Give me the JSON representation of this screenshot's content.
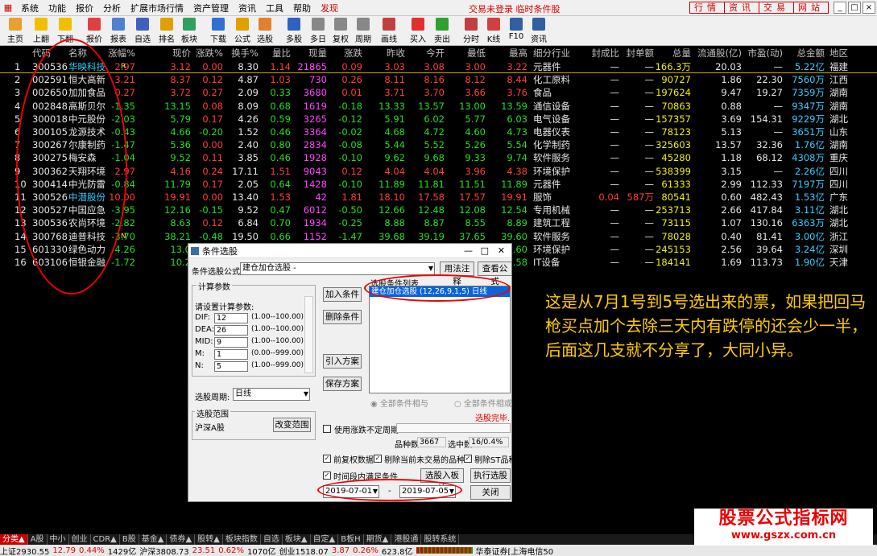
{
  "menu": {
    "items": [
      "系统",
      "功能",
      "报价",
      "分析",
      "扩展市场行情",
      "资产管理",
      "资讯",
      "工具",
      "帮助"
    ],
    "discover": "发现",
    "status": "交易未登录 临时条件股",
    "right_tabs": [
      "行情",
      "资讯",
      "交易",
      "网站"
    ],
    "win_buttons": [
      "_",
      "□",
      "×"
    ]
  },
  "toolbar": [
    "主页",
    "上翻",
    "下翻",
    "报价",
    "报表",
    "自选",
    "排名",
    "板块",
    "下载",
    "公式",
    "选股",
    "多股",
    "多日",
    "复权",
    "周期",
    "画线",
    "买入",
    "卖出",
    "分时",
    "K线",
    "F10",
    "资讯"
  ],
  "columns": [
    "代码",
    "名称",
    "涨幅%",
    "现价",
    "涨跌%",
    "换手%",
    "量比",
    "现量",
    "涨跌",
    "昨收",
    "今开",
    "最低",
    "最高",
    "细分行业",
    "封成比",
    "封单额",
    "总量",
    "流通股(亿)",
    "市盈(动)",
    "总金额",
    "地区"
  ],
  "rows": [
    {
      "n": "1",
      "code": "300536",
      "name": "华映科技",
      "mark": "R",
      "zf": "2.97",
      "xj": "3.12",
      "zd": "0.00",
      "hs": "8.30",
      "lb": "1.14",
      "xl": "21865",
      "zde": "0.09",
      "zs": "3.03",
      "jk": "3.08",
      "zdi": "3.00",
      "zg": "3.22",
      "hy": "元器件",
      "fcb": "—",
      "fde": "—",
      "zl": "166.3万",
      "lt": "20.03",
      "sy": "—",
      "je": "5.22亿",
      "dq": "福建"
    },
    {
      "n": "2",
      "code": "002591",
      "name": "恒大高新",
      "mark": "",
      "zf": "3.21",
      "xj": "8.37",
      "zd": "0.12",
      "hs": "4.87",
      "lb": "1.03",
      "xl": "730",
      "zde": "0.26",
      "zs": "8.11",
      "jk": "8.16",
      "zdi": "8.12",
      "zg": "8.44",
      "hy": "化工原料",
      "fcb": "—",
      "fde": "—",
      "zl": "90727",
      "lt": "1.86",
      "sy": "22.30",
      "je": "7560万",
      "dq": "江西"
    },
    {
      "n": "3",
      "code": "002650",
      "name": "加加食品",
      "mark": "",
      "zf": "0.27",
      "xj": "3.72",
      "zd": "0.27",
      "hs": "2.09",
      "lb": "0.33",
      "xl": "3680",
      "zde": "0.01",
      "zs": "3.71",
      "jk": "3.70",
      "zdi": "3.66",
      "zg": "3.76",
      "hy": "食品",
      "fcb": "—",
      "fde": "—",
      "zl": "197624",
      "lt": "9.47",
      "sy": "19.27",
      "je": "7359万",
      "dq": "湖南"
    },
    {
      "n": "4",
      "code": "002848",
      "name": "高斯贝尔",
      "mark": "",
      "zf": "-1.35",
      "xj": "13.15",
      "zd": "0.08",
      "hs": "8.09",
      "lb": "0.68",
      "xl": "1619",
      "zde": "-0.18",
      "zs": "13.33",
      "jk": "13.57",
      "zdi": "13.00",
      "zg": "13.59",
      "hy": "通信设备",
      "fcb": "—",
      "fde": "—",
      "zl": "70863",
      "lt": "0.88",
      "sy": "—",
      "je": "9347万",
      "dq": "湖南"
    },
    {
      "n": "5",
      "code": "300018",
      "name": "中元股份",
      "mark": "",
      "zf": "-2.03",
      "xj": "5.79",
      "zd": "0.17",
      "hs": "4.26",
      "lb": "0.59",
      "xl": "3265",
      "zde": "-0.12",
      "zs": "5.91",
      "jk": "6.02",
      "zdi": "5.77",
      "zg": "6.03",
      "hy": "电气设备",
      "fcb": "—",
      "fde": "—",
      "zl": "157357",
      "lt": "3.69",
      "sy": "154.31",
      "je": "9229万",
      "dq": "湖北"
    },
    {
      "n": "6",
      "code": "300105",
      "name": "龙源技术",
      "mark": "",
      "zf": "-0.43",
      "xj": "4.66",
      "zd": "-0.20",
      "hs": "1.52",
      "lb": "0.46",
      "xl": "3364",
      "zde": "-0.02",
      "zs": "4.68",
      "jk": "4.72",
      "zdi": "4.60",
      "zg": "4.73",
      "hy": "电器仪表",
      "fcb": "—",
      "fde": "—",
      "zl": "78123",
      "lt": "5.13",
      "sy": "—",
      "je": "3651万",
      "dq": "山东"
    },
    {
      "n": "7",
      "code": "300267",
      "name": "尔康制药",
      "mark": "",
      "zf": "-1.47",
      "xj": "5.36",
      "zd": "0.00",
      "hs": "2.40",
      "lb": "0.80",
      "xl": "2834",
      "zde": "-0.08",
      "zs": "5.44",
      "jk": "5.52",
      "zdi": "5.26",
      "zg": "5.54",
      "hy": "化学制药",
      "fcb": "—",
      "fde": "—",
      "zl": "325603",
      "lt": "13.57",
      "sy": "32.36",
      "je": "1.76亿",
      "dq": "湖南"
    },
    {
      "n": "8",
      "code": "300275",
      "name": "梅安森",
      "mark": "",
      "zf": "-1.04",
      "xj": "9.52",
      "zd": "0.11",
      "hs": "3.85",
      "lb": "0.46",
      "xl": "1928",
      "zde": "-0.10",
      "zs": "9.62",
      "jk": "9.68",
      "zdi": "9.33",
      "zg": "9.74",
      "hy": "软件服务",
      "fcb": "—",
      "fde": "—",
      "zl": "45280",
      "lt": "1.18",
      "sy": "68.12",
      "je": "4308万",
      "dq": "重庆"
    },
    {
      "n": "9",
      "code": "300362",
      "name": "天翔环境",
      "mark": "",
      "zf": "2.97",
      "xj": "4.16",
      "zd": "0.24",
      "hs": "17.11",
      "lb": "1.51",
      "xl": "9043",
      "zde": "0.12",
      "zs": "4.04",
      "jk": "4.04",
      "zdi": "3.96",
      "zg": "4.38",
      "hy": "环境保护",
      "fcb": "—",
      "fde": "—",
      "zl": "538399",
      "lt": "3.15",
      "sy": "—",
      "je": "2.26亿",
      "dq": "四川"
    },
    {
      "n": "10",
      "code": "300414",
      "name": "中光防雷",
      "mark": "",
      "zf": "-0.84",
      "xj": "11.79",
      "zd": "0.17",
      "hs": "2.05",
      "lb": "0.64",
      "xl": "1428",
      "zde": "-0.10",
      "zs": "11.89",
      "jk": "11.81",
      "zdi": "11.51",
      "zg": "11.89",
      "hy": "元器件",
      "fcb": "—",
      "fde": "—",
      "zl": "61333",
      "lt": "2.99",
      "sy": "112.33",
      "je": "7197万",
      "dq": "四川"
    },
    {
      "n": "11",
      "code": "300526",
      "name": "中潜股份",
      "mark": "",
      "zf": "10.00",
      "xj": "19.91",
      "zd": "0.00",
      "hs": "13.40",
      "lb": "1.53",
      "xl": "42",
      "zde": "1.81",
      "zs": "18.10",
      "jk": "17.58",
      "zdi": "17.57",
      "zg": "19.91",
      "hy": "服饰",
      "fcb": "0.04",
      "fde": "587万",
      "zl": "80541",
      "lt": "0.60",
      "sy": "482.43",
      "je": "1.53亿",
      "dq": "广东"
    },
    {
      "n": "12",
      "code": "300527",
      "name": "中国应急",
      "mark": "",
      "zf": "-3.95",
      "xj": "12.16",
      "zd": "-0.15",
      "hs": "9.52",
      "lb": "0.47",
      "xl": "6012",
      "zde": "-0.50",
      "zs": "12.66",
      "jk": "12.48",
      "zdi": "12.08",
      "zg": "12.54",
      "hy": "专用机械",
      "fcb": "—",
      "fde": "—",
      "zl": "253713",
      "lt": "2.66",
      "sy": "417.84",
      "je": "3.11亿",
      "dq": "湖北"
    },
    {
      "n": "13",
      "code": "300536",
      "name": "农尚环境",
      "mark": "",
      "zf": "-2.82",
      "xj": "8.63",
      "zd": "0.12",
      "hs": "6.84",
      "lb": "0.70",
      "xl": "1934",
      "zde": "-0.25",
      "zs": "8.88",
      "jk": "8.87",
      "zdi": "8.55",
      "zg": "8.89",
      "hy": "建筑工程",
      "fcb": "—",
      "fde": "—",
      "zl": "73115",
      "lt": "1.07",
      "sy": "130.16",
      "je": "6363万",
      "dq": "湖北"
    },
    {
      "n": "14",
      "code": "300768",
      "name": "迪普科技",
      "mark": "N",
      "zf": "-3.70",
      "xj": "38.21",
      "zd": "-0.48",
      "hs": "19.50",
      "lb": "0.66",
      "xl": "1152",
      "zde": "-1.47",
      "zs": "39.68",
      "jk": "39.19",
      "zdi": "37.65",
      "zg": "39.60",
      "hy": "软件服务",
      "fcb": "—",
      "fde": "—",
      "zl": "78028",
      "lt": "0.40",
      "sy": "81.41",
      "je": "3.00亿",
      "dq": "浙江"
    },
    {
      "n": "15",
      "code": "601330",
      "name": "绿色动力",
      "mark": "",
      "zf": "-4.26",
      "xj": "13.0",
      "zd": "",
      "hs": "",
      "lb": "",
      "xl": "",
      "zde": "",
      "zs": "",
      "jk": "",
      "zdi": "",
      "zg": ".60",
      "hy": "环境保护",
      "fcb": "—",
      "fde": "—",
      "zl": "245153",
      "lt": "2.56",
      "sy": "39.64",
      "je": "3.24亿",
      "dq": "深圳"
    },
    {
      "n": "16",
      "code": "603106",
      "name": "恒银金融",
      "mark": "",
      "zf": "-1.72",
      "xj": "10.2",
      "zd": "",
      "hs": "",
      "lb": "",
      "xl": "",
      "zde": "",
      "zs": "",
      "jk": "",
      "zdi": "",
      "zg": ".58",
      "hy": "IT设备",
      "fcb": "—",
      "fde": "—",
      "zl": "184141",
      "lt": "1.69",
      "sy": "113.73",
      "je": "1.90亿",
      "dq": "天津"
    }
  ],
  "dialog": {
    "title": "条件选股",
    "formula_label": "条件选股公式",
    "formula_value": "建仓加仓选股 -",
    "usage_btn": "用法注释",
    "view_btn": "查看公式",
    "params_group": "计算参数",
    "params_prompt": "请设置计算参数:",
    "params": [
      {
        "k": "DIF:",
        "v": "12",
        "r": "(1.00--100.00)"
      },
      {
        "k": "DEA:",
        "v": "26",
        "r": "(1.00--100.00)"
      },
      {
        "k": "MID:",
        "v": "9",
        "r": "(1.00--100.00)"
      },
      {
        "k": "M:",
        "v": "1",
        "r": "(0.00--999.00)"
      },
      {
        "k": "N:",
        "v": "5",
        "r": "(1.00--999.00)"
      }
    ],
    "cond_list_label": "选股条件列表",
    "cond_item": "建仓加仓选股 (12,26,9,1,5) 日线",
    "add_btn": "加入条件",
    "del_btn": "删除条件",
    "import_btn": "引入方案",
    "save_btn": "保存方案",
    "radio_and": "全部条件相与",
    "radio_or": "全部条件相或",
    "period_label": "选股周期:",
    "period_value": "日线",
    "done": "选股完毕.",
    "range_group": "选股范围",
    "range_value": "沪深A股",
    "range_btn": "改变范围",
    "cb_range": "使用涨跌不定周期",
    "count_label": "品种数",
    "count_value": "3667",
    "sel_label": "选中数",
    "sel_value": "16/0.4%",
    "cb_prefq": "前复权数据",
    "cb_excl_untraded": "剔除当前未交易的品种",
    "cb_excl_st": "剔除ST品种",
    "cb_time": "时间段内满足条件",
    "to_block_btn": "选股入板块",
    "run_btn": "执行选股",
    "close_btn": "关闭",
    "date_from": "2019-07-01",
    "date_sep": "-",
    "date_to": "2019-07-05"
  },
  "annotation": "这是从7月1号到5号选出来的票，如果把回马枪买点加个去除三天内有跌停的还会少一半，后面这几支就不分享了，大同小异。",
  "tabs": [
    "分类▲",
    "A股",
    "中小",
    "创业",
    "CDR▲",
    "B股",
    "基金▲",
    "债券▲",
    "股转▲",
    "板块指数",
    "自选",
    "板块▲",
    "自定▲",
    "B板H",
    "期货▲",
    "港股通",
    "股转系统"
  ],
  "status": {
    "sh": "上证2930.55",
    "sh_chg": "12.79",
    "sh_pct": "0.44%",
    "sh_amt": "1429亿",
    "sz": "沪深3808.73",
    "sz_chg": "23.51",
    "sz_pct": "0.62%",
    "sz_amt": "1070亿",
    "cy": "创业1518.07",
    "cy_chg": "3.87",
    "cy_pct": "0.26%",
    "cy_amt": "623.8亿",
    "broker": "华泰证券[上海电信50"
  },
  "watermark": {
    "title": "股票公式指标网",
    "url": "www.gszx.com.cn"
  }
}
